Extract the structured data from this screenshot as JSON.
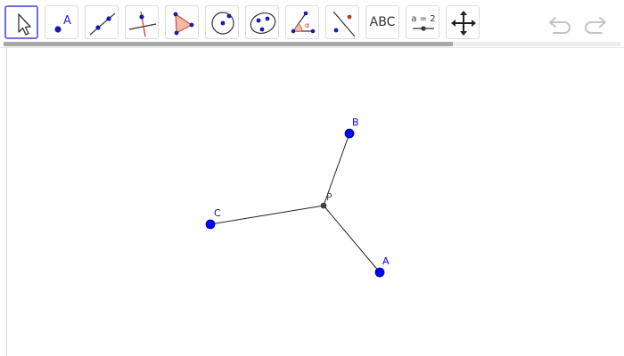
{
  "toolbar": {
    "tools": [
      {
        "icon": "move-arrow-icon",
        "active": true
      },
      {
        "icon": "point-icon",
        "label": "A"
      },
      {
        "icon": "line-icon"
      },
      {
        "icon": "perpendicular-line-icon"
      },
      {
        "icon": "polygon-icon"
      },
      {
        "icon": "circle-icon"
      },
      {
        "icon": "ellipse-icon"
      },
      {
        "icon": "angle-icon",
        "label": "α"
      },
      {
        "icon": "reflect-icon"
      },
      {
        "icon": "text-icon",
        "label": "ABC"
      },
      {
        "icon": "slider-icon",
        "label": "a = 2"
      },
      {
        "icon": "move-view-icon"
      }
    ],
    "undo_icon": "undo-icon",
    "redo_icon": "redo-icon"
  },
  "construction": {
    "points": [
      {
        "name": "B",
        "color": "#0000ff"
      },
      {
        "name": "C",
        "color": "#0000ff"
      },
      {
        "name": "A",
        "color": "#0000ff"
      },
      {
        "name": "P",
        "color": "#444444"
      }
    ],
    "segments": [
      "PB",
      "PC",
      "PA"
    ]
  }
}
